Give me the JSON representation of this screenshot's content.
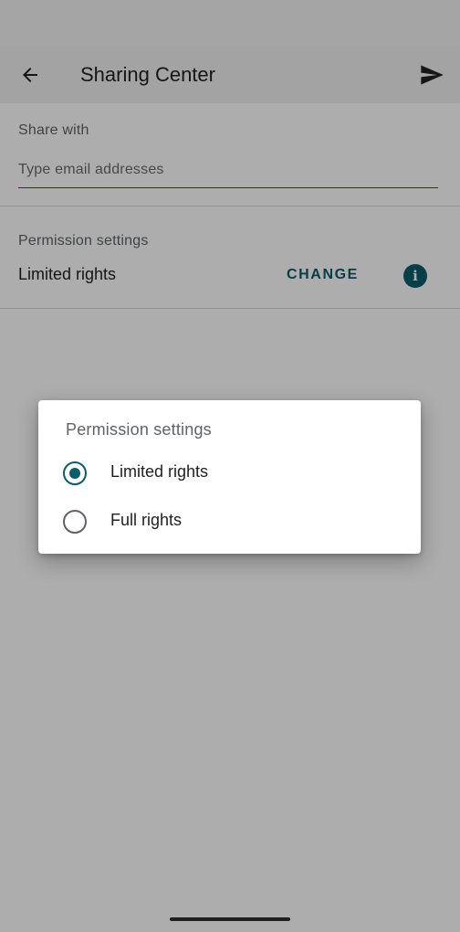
{
  "app_bar": {
    "title": "Sharing Center",
    "back_icon": "arrow-back-icon",
    "send_icon": "send-icon"
  },
  "share": {
    "label": "Share with",
    "placeholder": "Type email addresses",
    "value": ""
  },
  "permissions": {
    "label": "Permission settings",
    "value": "Limited rights",
    "change_label": "CHANGE",
    "info_icon": "info-icon",
    "info_glyph": "i"
  },
  "dialog": {
    "title": "Permission settings",
    "options": [
      {
        "label": "Limited rights",
        "selected": true
      },
      {
        "label": "Full rights",
        "selected": false
      }
    ]
  },
  "colors": {
    "accent": "#0b5d6b",
    "scrim": "rgba(0,0,0,0.32)"
  }
}
